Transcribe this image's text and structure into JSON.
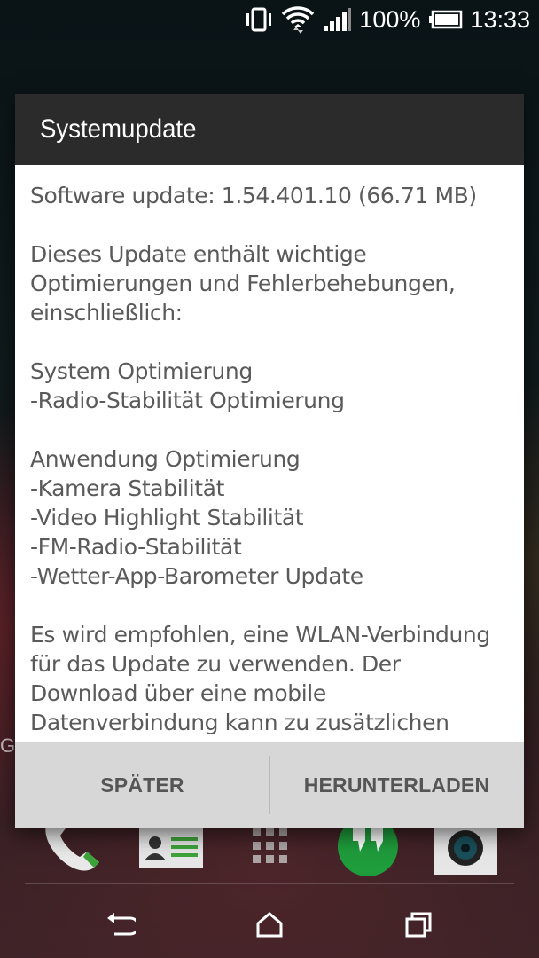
{
  "status_bar": {
    "battery_percent": "100%",
    "time": "13:33",
    "icons": [
      "vibrate-icon",
      "wifi-icon",
      "signal-icon",
      "battery-icon"
    ]
  },
  "edge_letter": "G",
  "dialog": {
    "title": "Systemupdate",
    "body": {
      "version_line": "Software update: 1.54.401.10 (66.71 MB)",
      "intro": [
        "Dieses Update enthält wichtige",
        "Optimierungen und Fehlerbehebungen,",
        "einschließlich:"
      ],
      "system_section": [
        "System Optimierung",
        "-Radio-Stabilität Optimierung"
      ],
      "app_section": [
        "Anwendung Optimierung",
        "-Kamera Stabilität",
        "-Video Highlight Stabilität",
        "-FM-Radio-Stabilität",
        "-Wetter-App-Barometer Update"
      ],
      "recommendation": [
        "Es wird empfohlen, eine WLAN-Verbindung",
        "für das Update zu verwenden. Der",
        "Download über eine mobile",
        "Datenverbindung kann zu zusätzlichen"
      ]
    },
    "buttons": {
      "later": "SPÄTER",
      "download": "HERUNTERLADEN"
    }
  },
  "dock": {
    "items": [
      "phone-icon",
      "contacts-icon",
      "app-drawer-icon",
      "hangouts-icon",
      "camera-icon"
    ]
  },
  "nav": {
    "items": [
      "back-icon",
      "home-icon",
      "recents-icon"
    ]
  },
  "colors": {
    "dialog_header": "#2b2b2b",
    "dialog_footer": "#d7d7d7",
    "hangouts_green": "#1f9c3c",
    "phone_green": "#3da43a"
  }
}
